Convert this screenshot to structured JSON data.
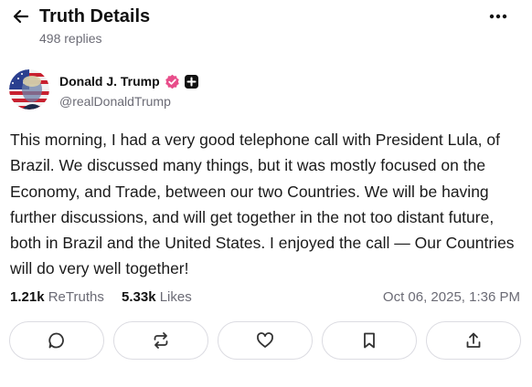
{
  "header": {
    "title": "Truth Details",
    "replies": "498 replies",
    "back_icon": "arrow-left-icon",
    "more_icon": "more-horizontal-icon"
  },
  "author": {
    "name": "Donald J. Trump",
    "handle": "@realDonaldTrump",
    "verified_color": "#e84d8a",
    "avatar_icon": "user-avatar"
  },
  "post": {
    "text": "This morning, I had a very good telephone call with President Lula, of Brazil. We discussed many things, but it was mostly focused on the Economy, and Trade, between our two Countries. We will be having further discussions, and will get together in the not too distant future, both in Brazil and the United States. I enjoyed the call — Our Countries will do very well together!"
  },
  "stats": {
    "retruths_count": "1.21k",
    "retruths_label": "ReTruths",
    "likes_count": "5.33k",
    "likes_label": "Likes",
    "timestamp": "Oct 06, 2025, 1:36 PM"
  },
  "actions": [
    {
      "icon": "reply-icon"
    },
    {
      "icon": "retruth-icon"
    },
    {
      "icon": "like-icon"
    },
    {
      "icon": "bookmark-icon"
    },
    {
      "icon": "share-icon"
    }
  ]
}
